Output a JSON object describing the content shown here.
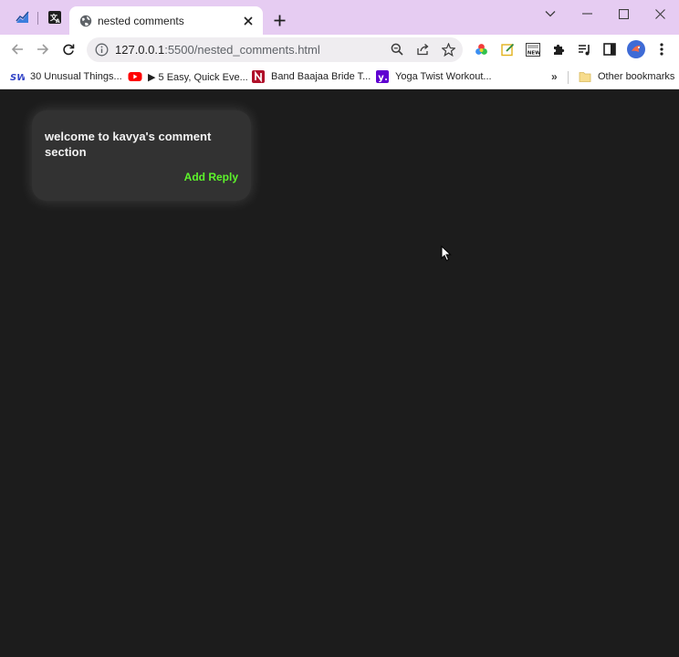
{
  "browser": {
    "tab_title": "nested comments",
    "url_host": "127.0.0.1",
    "url_path": ":5500/nested_comments.html",
    "accent": "#e6ccf2"
  },
  "bookmarks": [
    {
      "label": "30 Unusual Things...",
      "icon": "sw-favicon-icon"
    },
    {
      "label": "▶ 5 Easy, Quick Eve...",
      "icon": "youtube-icon"
    },
    {
      "label": "Band Baajaa Bride T...",
      "icon": "netflix-icon"
    },
    {
      "label": "Yoga Twist Workout...",
      "icon": "yahoo-icon"
    }
  ],
  "other_bookmarks": "Other bookmarks",
  "page": {
    "background": "#1c1c1c",
    "comment": {
      "text": "welcome to kavya's comment section",
      "reply_label": "Add Reply",
      "reply_color": "#5df42b"
    }
  }
}
